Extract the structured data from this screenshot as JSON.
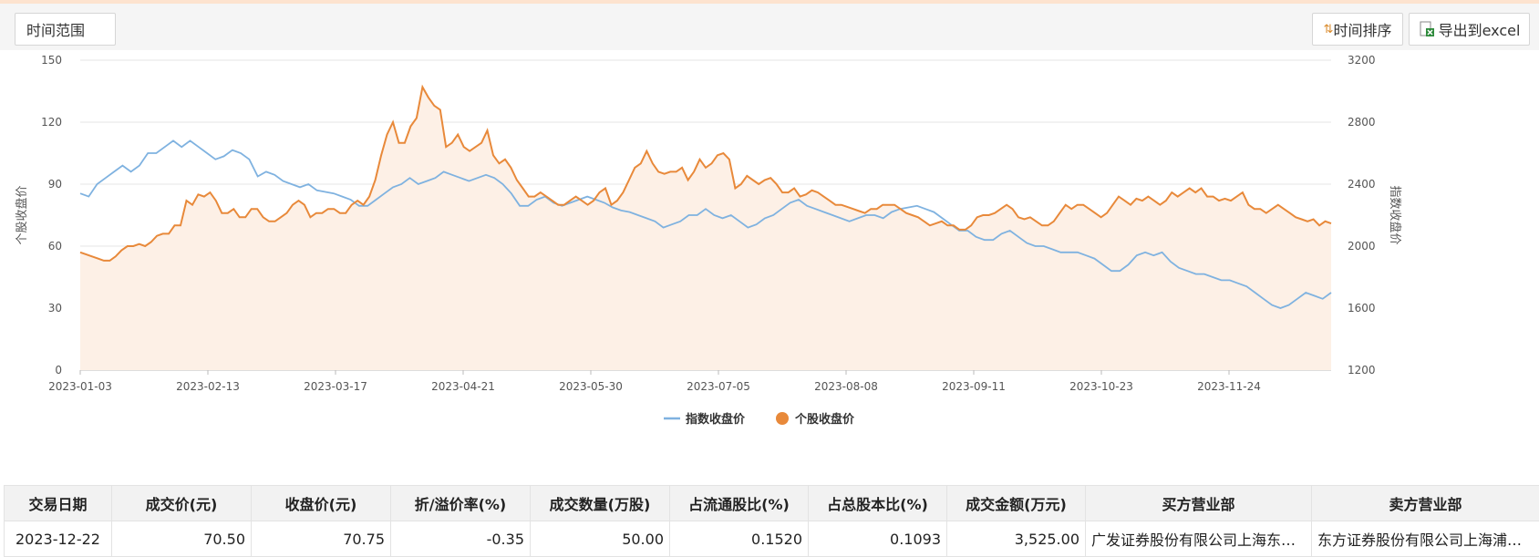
{
  "toolbar": {
    "time_range_label": "时间范围",
    "sort_label": "时间排序",
    "export_label": "导出到excel"
  },
  "colors": {
    "index_line": "#7fb2e0",
    "stock_line": "#e8893a",
    "stock_area": "#fdf0e6"
  },
  "icons": {
    "sort": "sort-arrows-icon",
    "export": "excel-export-icon"
  },
  "chart_data": {
    "type": "line",
    "left_axis": {
      "label": "个股收盘价",
      "ticks": [
        0,
        30,
        60,
        90,
        120,
        150
      ],
      "range": [
        0,
        150
      ]
    },
    "right_axis": {
      "label": "指数收盘价",
      "ticks": [
        1200,
        1600,
        2000,
        2400,
        2800,
        3200
      ],
      "range": [
        1200,
        3200
      ]
    },
    "x_tick_labels": [
      "2023-01-03",
      "2023-02-13",
      "2023-03-17",
      "2023-04-21",
      "2023-05-30",
      "2023-07-05",
      "2023-08-08",
      "2023-09-11",
      "2023-10-23",
      "2023-11-24"
    ],
    "grid": true,
    "legend_position": "bottom-center",
    "series": [
      {
        "name": "指数收盘价",
        "axis": "right",
        "values": [
          2340,
          2320,
          2400,
          2440,
          2480,
          2520,
          2480,
          2520,
          2600,
          2600,
          2640,
          2680,
          2640,
          2680,
          2640,
          2600,
          2560,
          2580,
          2620,
          2600,
          2560,
          2450,
          2480,
          2460,
          2420,
          2400,
          2380,
          2400,
          2360,
          2350,
          2340,
          2320,
          2300,
          2260,
          2260,
          2300,
          2340,
          2380,
          2400,
          2440,
          2400,
          2420,
          2440,
          2480,
          2460,
          2440,
          2420,
          2440,
          2460,
          2440,
          2400,
          2340,
          2260,
          2260,
          2300,
          2320,
          2280,
          2260,
          2280,
          2300,
          2320,
          2300,
          2280,
          2250,
          2230,
          2220,
          2200,
          2180,
          2160,
          2120,
          2140,
          2160,
          2200,
          2200,
          2240,
          2200,
          2180,
          2200,
          2160,
          2120,
          2140,
          2180,
          2200,
          2240,
          2280,
          2300,
          2260,
          2240,
          2220,
          2200,
          2180,
          2160,
          2180,
          2200,
          2200,
          2180,
          2220,
          2240,
          2250,
          2260,
          2240,
          2220,
          2180,
          2140,
          2100,
          2100,
          2060,
          2040,
          2040,
          2080,
          2100,
          2060,
          2020,
          2000,
          2000,
          1980,
          1960,
          1960,
          1960,
          1940,
          1920,
          1880,
          1840,
          1840,
          1880,
          1940,
          1960,
          1940,
          1960,
          1900,
          1860,
          1840,
          1820,
          1820,
          1800,
          1780,
          1780,
          1760,
          1740,
          1700,
          1660,
          1620,
          1600,
          1620,
          1660,
          1700,
          1680,
          1660,
          1700
        ]
      },
      {
        "name": "个股收盘价",
        "axis": "left",
        "values": [
          57,
          56,
          55,
          54,
          53,
          53,
          55,
          58,
          60,
          60,
          61,
          60,
          62,
          65,
          66,
          66,
          70,
          70,
          82,
          80,
          85,
          84,
          86,
          82,
          76,
          76,
          78,
          74,
          74,
          78,
          78,
          74,
          72,
          72,
          74,
          76,
          80,
          82,
          80,
          74,
          76,
          76,
          78,
          78,
          76,
          76,
          80,
          82,
          80,
          84,
          92,
          104,
          114,
          120,
          110,
          110,
          118,
          122,
          137,
          132,
          128,
          126,
          108,
          110,
          114,
          108,
          106,
          108,
          110,
          116,
          104,
          100,
          102,
          98,
          92,
          88,
          84,
          84,
          86,
          84,
          82,
          80,
          80,
          82,
          84,
          82,
          80,
          82,
          86,
          88,
          80,
          82,
          86,
          92,
          98,
          100,
          106,
          100,
          96,
          95,
          96,
          96,
          98,
          92,
          96,
          102,
          98,
          100,
          104,
          105,
          102,
          88,
          90,
          94,
          92,
          90,
          92,
          93,
          90,
          86,
          86,
          88,
          84,
          85,
          87,
          86,
          84,
          82,
          80,
          80,
          79,
          78,
          77,
          76,
          78,
          78,
          80,
          80,
          80,
          78,
          76,
          75,
          74,
          72,
          70,
          71,
          72,
          70,
          70,
          68,
          68,
          70,
          74,
          75,
          75,
          76,
          78,
          80,
          78,
          74,
          73,
          74,
          72,
          70,
          70,
          72,
          76,
          80,
          78,
          80,
          80,
          78,
          76,
          74,
          76,
          80,
          84,
          82,
          80,
          83,
          82,
          84,
          82,
          80,
          82,
          86,
          84,
          86,
          88,
          86,
          88,
          84,
          84,
          82,
          83,
          82,
          84,
          86,
          80,
          78,
          78,
          76,
          78,
          80,
          78,
          76,
          74,
          73,
          72,
          73,
          70,
          72,
          71
        ]
      }
    ]
  },
  "table": {
    "headers": [
      "交易日期",
      "成交价(元)",
      "收盘价(元)",
      "折/溢价率(%)",
      "成交数量(万股)",
      "占流通股比(%)",
      "占总股本比(%)",
      "成交金额(万元)",
      "买方营业部",
      "卖方营业部"
    ],
    "rows": [
      [
        "2023-12-22",
        "70.50",
        "70.75",
        "-0.35",
        "50.00",
        "0.1520",
        "0.1093",
        "3,525.00",
        "广发证券股份有限公司上海东方路证券营业部",
        "东方证券股份有限公司上海浦东新区证券营业部"
      ]
    ]
  }
}
